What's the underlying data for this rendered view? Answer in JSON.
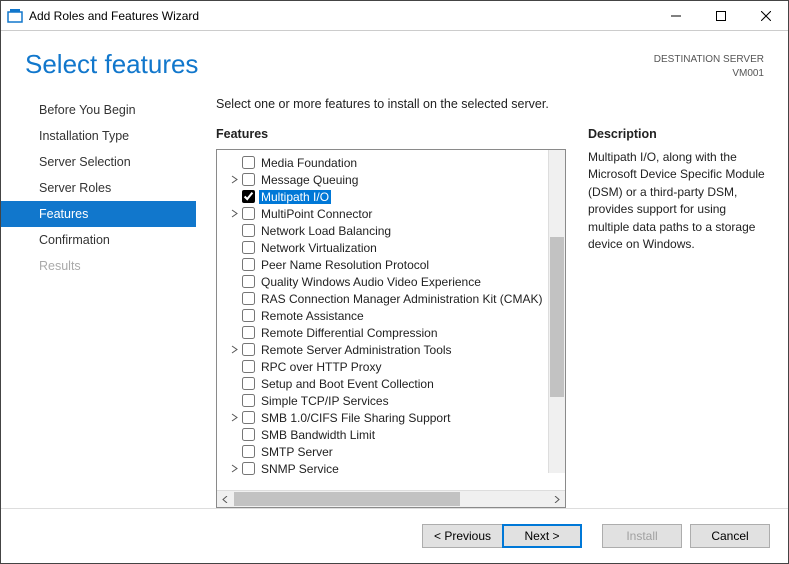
{
  "window": {
    "title": "Add Roles and Features Wizard"
  },
  "header": {
    "page_title": "Select features",
    "dest_label": "DESTINATION SERVER",
    "dest_value": "VM001"
  },
  "nav": {
    "items": [
      {
        "label": "Before You Begin",
        "state": "normal"
      },
      {
        "label": "Installation Type",
        "state": "normal"
      },
      {
        "label": "Server Selection",
        "state": "normal"
      },
      {
        "label": "Server Roles",
        "state": "normal"
      },
      {
        "label": "Features",
        "state": "active"
      },
      {
        "label": "Confirmation",
        "state": "normal"
      },
      {
        "label": "Results",
        "state": "disabled"
      }
    ]
  },
  "content": {
    "instruction": "Select one or more features to install on the selected server.",
    "features_heading": "Features",
    "description_heading": "Description",
    "description_text": "Multipath I/O, along with the Microsoft Device Specific Module (DSM) or a third-party DSM, provides support for using multiple data paths to a storage device on Windows."
  },
  "features": [
    {
      "label": "Media Foundation",
      "checked": false,
      "expandable": false,
      "selected": false
    },
    {
      "label": "Message Queuing",
      "checked": false,
      "expandable": true,
      "selected": false
    },
    {
      "label": "Multipath I/O",
      "checked": true,
      "expandable": false,
      "selected": true
    },
    {
      "label": "MultiPoint Connector",
      "checked": false,
      "expandable": true,
      "selected": false
    },
    {
      "label": "Network Load Balancing",
      "checked": false,
      "expandable": false,
      "selected": false
    },
    {
      "label": "Network Virtualization",
      "checked": false,
      "expandable": false,
      "selected": false
    },
    {
      "label": "Peer Name Resolution Protocol",
      "checked": false,
      "expandable": false,
      "selected": false
    },
    {
      "label": "Quality Windows Audio Video Experience",
      "checked": false,
      "expandable": false,
      "selected": false
    },
    {
      "label": "RAS Connection Manager Administration Kit (CMAK)",
      "checked": false,
      "expandable": false,
      "selected": false
    },
    {
      "label": "Remote Assistance",
      "checked": false,
      "expandable": false,
      "selected": false
    },
    {
      "label": "Remote Differential Compression",
      "checked": false,
      "expandable": false,
      "selected": false
    },
    {
      "label": "Remote Server Administration Tools",
      "checked": false,
      "expandable": true,
      "selected": false
    },
    {
      "label": "RPC over HTTP Proxy",
      "checked": false,
      "expandable": false,
      "selected": false
    },
    {
      "label": "Setup and Boot Event Collection",
      "checked": false,
      "expandable": false,
      "selected": false
    },
    {
      "label": "Simple TCP/IP Services",
      "checked": false,
      "expandable": false,
      "selected": false
    },
    {
      "label": "SMB 1.0/CIFS File Sharing Support",
      "checked": false,
      "expandable": true,
      "selected": false
    },
    {
      "label": "SMB Bandwidth Limit",
      "checked": false,
      "expandable": false,
      "selected": false
    },
    {
      "label": "SMTP Server",
      "checked": false,
      "expandable": false,
      "selected": false
    },
    {
      "label": "SNMP Service",
      "checked": false,
      "expandable": true,
      "selected": false
    }
  ],
  "footer": {
    "previous": "< Previous",
    "next": "Next >",
    "install": "Install",
    "cancel": "Cancel"
  }
}
